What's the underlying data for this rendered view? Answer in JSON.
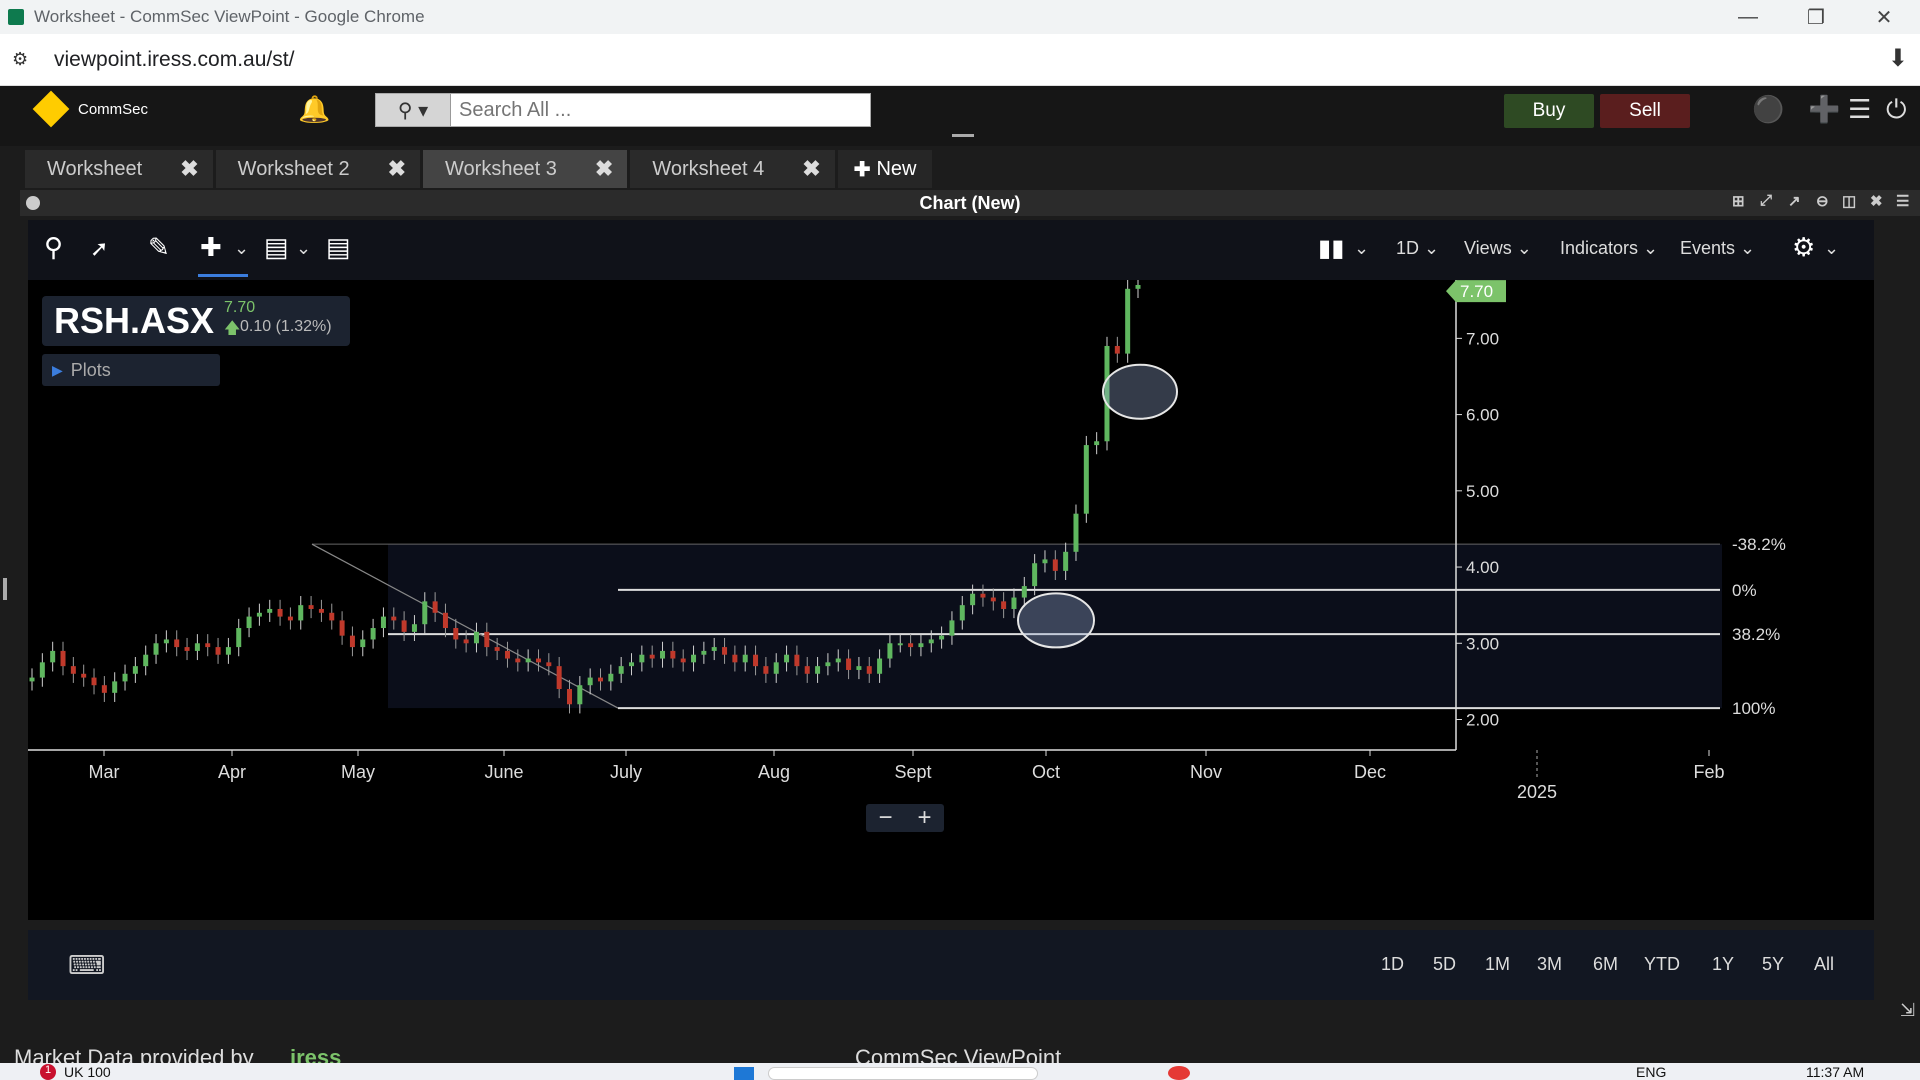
{
  "browser": {
    "title": "Worksheet - CommSec ViewPoint - Google Chrome",
    "url": "viewpoint.iress.com.au/st/"
  },
  "header": {
    "logo": "CommSec",
    "search_placeholder": "Search All ...",
    "buy": "Buy",
    "sell": "Sell"
  },
  "tabs": [
    {
      "label": "Worksheet"
    },
    {
      "label": "Worksheet 2"
    },
    {
      "label": "Worksheet 3"
    },
    {
      "label": "Worksheet 4"
    }
  ],
  "new_tab": "New",
  "panel": {
    "title": "Chart (New)"
  },
  "toolbar": {
    "interval": "1D",
    "views": "Views",
    "indicators": "Indicators",
    "events": "Events"
  },
  "quote": {
    "symbol": "RSH.ASX",
    "price": "7.70",
    "change": "0.10 (1.32%)",
    "plots": "Plots"
  },
  "ranges": [
    "1D",
    "5D",
    "1M",
    "3M",
    "6M",
    "YTD",
    "1Y",
    "5Y",
    "All"
  ],
  "footer": {
    "market_data": "Market Data provided by",
    "provider": "iress",
    "center": "CommSec ViewPoint"
  },
  "taskbar": {
    "notification": "1",
    "ticker": "UK 100",
    "lang": "ENG",
    "time": "11:37 AM"
  },
  "colors": {
    "up": "#5fb75f",
    "down": "#c0392b",
    "price_tag": "#7cc36a"
  },
  "chart_data": {
    "type": "candlestick",
    "last_price_label": "7.70",
    "y_ticks": [
      "7.00",
      "6.00",
      "5.00",
      "4.00",
      "3.00",
      "2.00"
    ],
    "ylim": [
      1.6,
      7.7
    ],
    "x_ticks": [
      "Mar",
      "Apr",
      "May",
      "June",
      "July",
      "Aug",
      "Sept",
      "Oct",
      "Nov",
      "Dec",
      "Feb"
    ],
    "x_year_label": "2025",
    "fib_levels": [
      {
        "label": "-38.2%",
        "value": 4.3
      },
      {
        "label": "0%",
        "value": 3.7
      },
      {
        "label": "38.2%",
        "value": 3.12
      },
      {
        "label": "100%",
        "value": 2.15
      }
    ],
    "closes": [
      2.55,
      2.75,
      2.9,
      2.7,
      2.6,
      2.55,
      2.45,
      2.35,
      2.5,
      2.6,
      2.7,
      2.85,
      3.0,
      3.05,
      2.95,
      2.9,
      3.0,
      2.95,
      2.85,
      2.95,
      3.2,
      3.35,
      3.4,
      3.45,
      3.35,
      3.3,
      3.5,
      3.45,
      3.4,
      3.3,
      3.1,
      2.95,
      3.05,
      3.2,
      3.35,
      3.3,
      3.15,
      3.25,
      3.55,
      3.4,
      3.2,
      3.05,
      3.0,
      3.15,
      2.95,
      2.9,
      2.8,
      2.75,
      2.8,
      2.75,
      2.7,
      2.4,
      2.2,
      2.45,
      2.55,
      2.5,
      2.6,
      2.7,
      2.75,
      2.85,
      2.8,
      2.9,
      2.8,
      2.75,
      2.85,
      2.9,
      2.95,
      2.85,
      2.75,
      2.85,
      2.7,
      2.6,
      2.75,
      2.85,
      2.7,
      2.6,
      2.7,
      2.75,
      2.8,
      2.65,
      2.7,
      2.6,
      2.8,
      3.0,
      3.0,
      2.95,
      3.0,
      3.05,
      3.1,
      3.3,
      3.5,
      3.65,
      3.6,
      3.55,
      3.45,
      3.6,
      3.75,
      4.05,
      4.1,
      3.95,
      4.2,
      4.7,
      5.6,
      5.65,
      6.9,
      6.8,
      7.65,
      7.7
    ]
  }
}
